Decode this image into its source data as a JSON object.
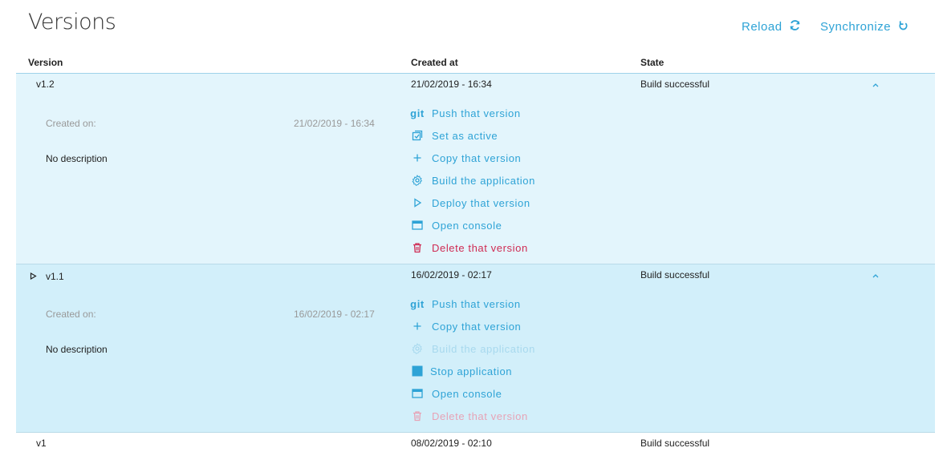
{
  "page": {
    "title": "Versions"
  },
  "toolbar": {
    "reload_label": "Reload",
    "sync_label": "Synchronize"
  },
  "table": {
    "columns": {
      "version": "Version",
      "created_at": "Created at",
      "state": "State"
    }
  },
  "versions": [
    {
      "name": "v1.2",
      "created_at": "21/02/2019 - 16:34",
      "state": "Build successful",
      "details": {
        "created_on_label": "Created on:",
        "created_on_value": "21/02/2019 - 16:34",
        "description": "No description"
      },
      "actions": {
        "push": "Push that version",
        "set_active": "Set as active",
        "copy": "Copy that version",
        "build": "Build the application",
        "deploy": "Deploy that version",
        "console": "Open console",
        "delete": "Delete that version"
      }
    },
    {
      "name": "v1.1",
      "created_at": "16/02/2019 - 02:17",
      "state": "Build successful",
      "details": {
        "created_on_label": "Created on:",
        "created_on_value": "16/02/2019 - 02:17",
        "description": "No description"
      },
      "actions": {
        "push": "Push that version",
        "copy": "Copy that version",
        "build": "Build the application",
        "stop": "Stop application",
        "console": "Open console",
        "delete": "Delete that version"
      }
    },
    {
      "name": "v1",
      "created_at": "08/02/2019 - 02:10",
      "state": "Build successful"
    }
  ],
  "icons": {
    "git_glyph": "git"
  },
  "colors": {
    "accent": "#2ea3d6",
    "danger": "#cf2b53",
    "panel_expanded": "#e3f5fc",
    "panel_running": "#d2effa"
  }
}
